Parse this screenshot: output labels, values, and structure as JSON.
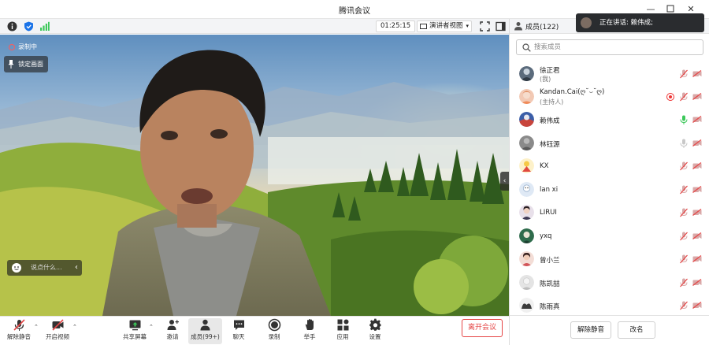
{
  "window": {
    "title": "腾讯会议"
  },
  "infobar": {
    "timer": "01:25:15",
    "view_mode": "演讲者视图"
  },
  "video": {
    "recording_label": "录制中",
    "pin_label": "锁定画面",
    "chat_placeholder": "说点什么..."
  },
  "toolbar": {
    "buttons": [
      {
        "label": "解除静音"
      },
      {
        "label": "开启视频"
      },
      {
        "label": "共享屏幕"
      },
      {
        "label": "邀请"
      },
      {
        "label": "成员(99+)"
      },
      {
        "label": "聊天"
      },
      {
        "label": "录制"
      },
      {
        "label": "举手"
      },
      {
        "label": "应用"
      },
      {
        "label": "设置"
      }
    ],
    "leave_label": "离开会议"
  },
  "panel": {
    "title": "成员(122)",
    "search_placeholder": "搜索成员",
    "members": [
      {
        "name": "徐正君",
        "role": "(我)"
      },
      {
        "name": "Kandan.Cai(ღ˘⌣˘ღ)",
        "role": "(主持人)"
      },
      {
        "name": "赖伟成"
      },
      {
        "name": "林钰源"
      },
      {
        "name": "KX"
      },
      {
        "name": "lan xi"
      },
      {
        "name": "LIRUI"
      },
      {
        "name": "yxq"
      },
      {
        "name": "曾小兰"
      },
      {
        "name": "陈凯喆"
      },
      {
        "name": "陈雨真"
      }
    ],
    "unmute_all": "解除静音",
    "rename": "改名"
  },
  "toast": {
    "text": "正在讲话: 赖伟成;"
  },
  "colors": {
    "accent_blue": "#1a73e8",
    "danger": "#e54545",
    "speaking_green": "#3cc85a"
  }
}
